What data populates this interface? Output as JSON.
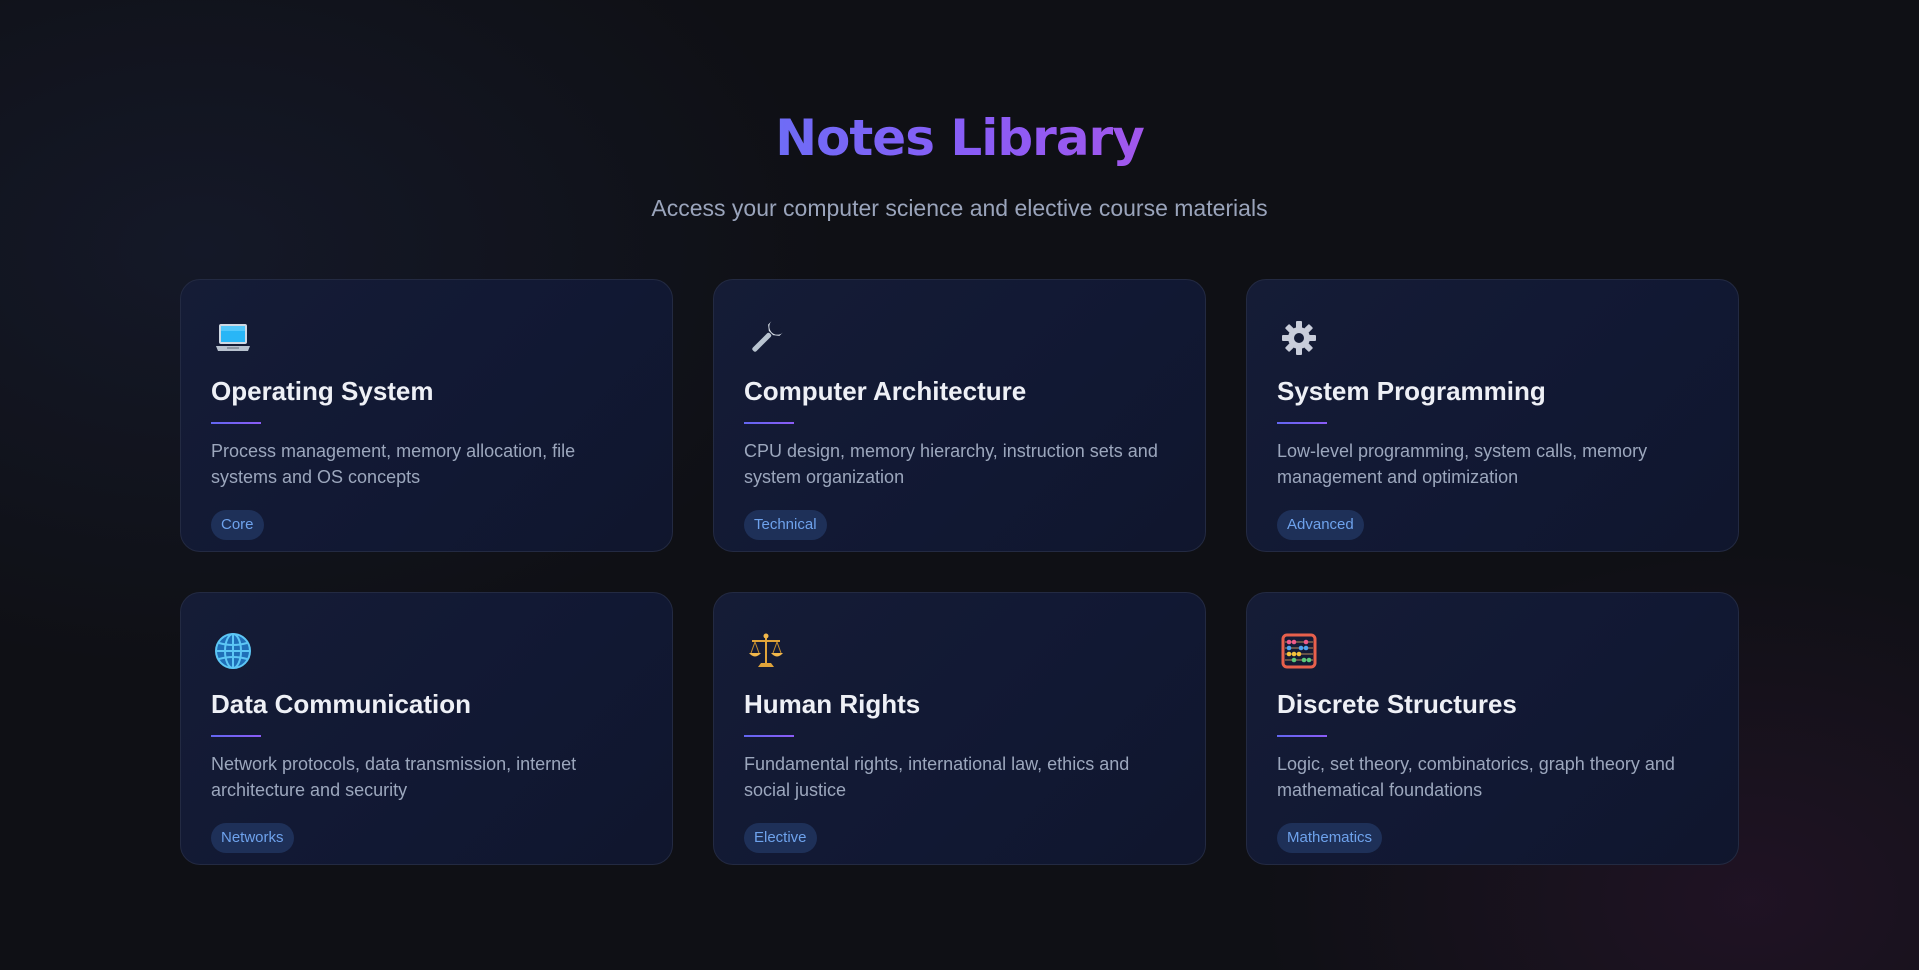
{
  "header": {
    "title": "Notes Library",
    "subtitle": "Access your computer science and elective course materials"
  },
  "colors": {
    "title_gradient_start": "#6e6cf6",
    "title_gradient_end": "#a257ec",
    "accent_line": "#6366f1",
    "badge_background": "#1e3058",
    "badge_text": "#6ea2ec"
  },
  "cards": [
    {
      "icon": "laptop-icon",
      "title": "Operating System",
      "description": "Process management, memory allocation, file systems and OS concepts",
      "tag": "Core"
    },
    {
      "icon": "wrench-icon",
      "title": "Computer Architecture",
      "description": "CPU design, memory hierarchy, instruction sets and system organization",
      "tag": "Technical"
    },
    {
      "icon": "gear-icon",
      "title": "System Programming",
      "description": "Low-level programming, system calls, memory management and optimization",
      "tag": "Advanced"
    },
    {
      "icon": "globe-icon",
      "title": "Data Communication",
      "description": "Network protocols, data transmission, internet architecture and security",
      "tag": "Networks"
    },
    {
      "icon": "scales-icon",
      "title": "Human Rights",
      "description": "Fundamental rights, international law, ethics and social justice",
      "tag": "Elective"
    },
    {
      "icon": "abacus-icon",
      "title": "Discrete Structures",
      "description": "Logic, set theory, combinatorics, graph theory and mathematical foundations",
      "tag": "Mathematics"
    }
  ]
}
